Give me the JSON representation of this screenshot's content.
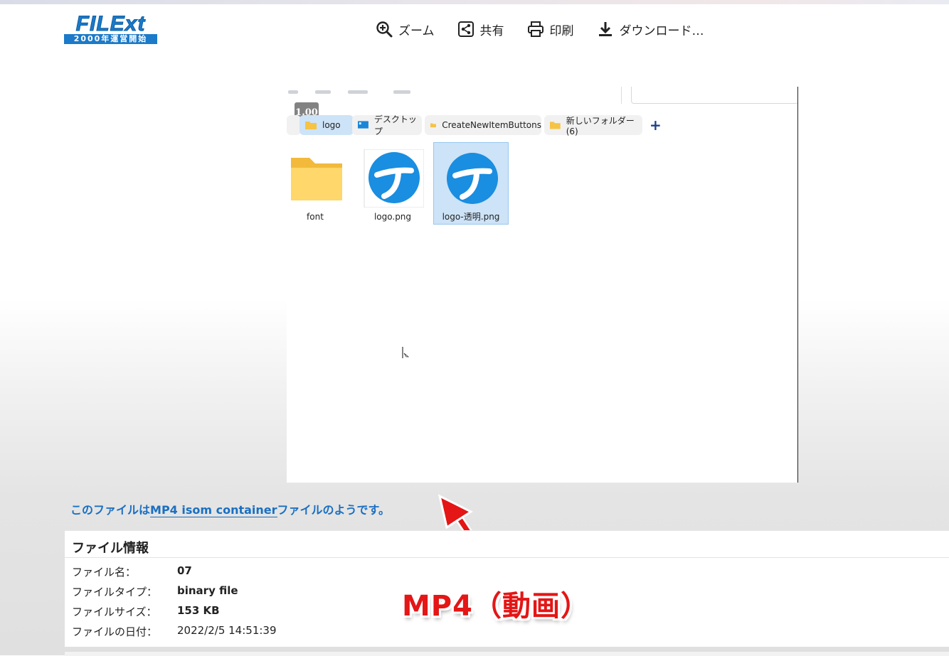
{
  "header": {
    "logo_brand": "FILExt",
    "logo_sub": "2000年運営開始",
    "actions": [
      {
        "label": "ズーム",
        "icon": "zoom-in-icon"
      },
      {
        "label": "共有",
        "icon": "share-icon"
      },
      {
        "label": "印刷",
        "icon": "printer-icon"
      },
      {
        "label": "ダウンロード…",
        "icon": "download-icon"
      }
    ]
  },
  "preview": {
    "zoom_badge": "1.00",
    "tabs": [
      {
        "label": "logo",
        "icon": "folder-icon"
      },
      {
        "label": "デスクトップ",
        "icon": "desktop-icon"
      },
      {
        "label": "CreateNewItemButtons",
        "icon": "folder-icon"
      },
      {
        "label": "新しいフォルダー (6)",
        "icon": "folder-icon"
      }
    ],
    "add_tab": "+",
    "files": [
      {
        "name": "font",
        "type": "folder"
      },
      {
        "name": "logo.png",
        "type": "image"
      },
      {
        "name": "logo-透明.png",
        "type": "image",
        "selected": true
      }
    ]
  },
  "filetype_sentence": {
    "prefix": "このファイルは",
    "link": "MP4 isom container",
    "suffix": "ファイルのようです。"
  },
  "file_info": {
    "title": "ファイル情報",
    "rows": [
      {
        "key": "ファイル名：",
        "value": "07"
      },
      {
        "key": "ファイルタイプ：",
        "value": "binary file"
      },
      {
        "key": "ファイルサイズ：",
        "value": "153 KB"
      },
      {
        "key": "ファイルの日付：",
        "value": "2022/2/5 14:51:39"
      }
    ]
  },
  "annotation": {
    "text": "MP4（動画）",
    "color": "#e41616"
  },
  "colors": {
    "link": "#1a6fc2",
    "brand": "#1b7ac9",
    "selection": "#cde3f7"
  }
}
